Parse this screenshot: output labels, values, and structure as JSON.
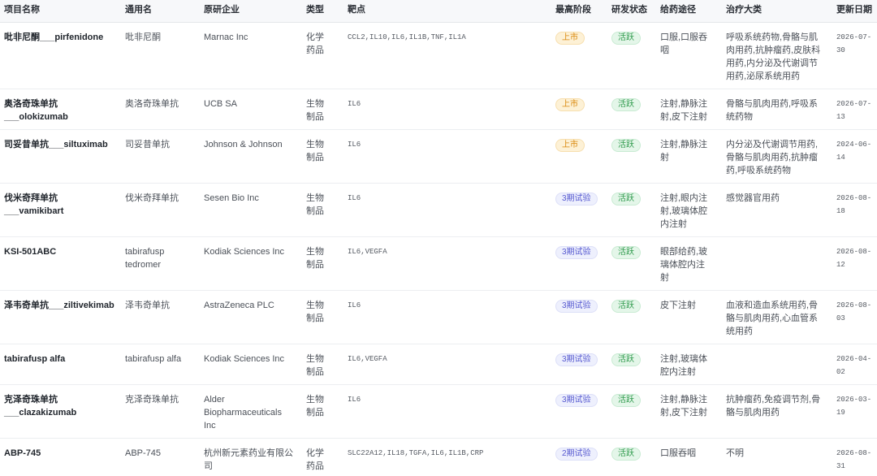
{
  "columns": [
    "项目名称",
    "通用名",
    "原研企业",
    "类型",
    "靶点",
    "最高阶段",
    "研发状态",
    "给药途径",
    "治疗大类",
    "更新日期"
  ],
  "rows": [
    {
      "name": "吡非尼酮___pirfenidone",
      "generic": "吡非尼酮",
      "company": "Marnac Inc",
      "type": "化学药品",
      "targets": "CCL2,IL10,IL6,IL1B,TNF,IL1A",
      "stage": "上市",
      "status": "活跃",
      "route": "口服,口服吞咽",
      "category": "呼吸系统药物,骨骼与肌肉用药,抗肿瘤药,皮肤科用药,内分泌及代谢调节用药,泌尿系统用药",
      "updated": "2026-07-30"
    },
    {
      "name": "奥洛奇珠单抗___olokizumab",
      "generic": "奥洛奇珠单抗",
      "company": "UCB SA",
      "type": "生物制品",
      "targets": "IL6",
      "stage": "上市",
      "status": "活跃",
      "route": "注射,静脉注射,皮下注射",
      "category": "骨骼与肌肉用药,呼吸系统药物",
      "updated": "2026-07-13"
    },
    {
      "name": "司妥昔单抗___siltuximab",
      "generic": "司妥昔单抗",
      "company": "Johnson & Johnson",
      "type": "生物制品",
      "targets": "IL6",
      "stage": "上市",
      "status": "活跃",
      "route": "注射,静脉注射",
      "category": "内分泌及代谢调节用药,骨骼与肌肉用药,抗肿瘤药,呼吸系统药物",
      "updated": "2024-06-14"
    },
    {
      "name": "伐米奇拜单抗___vamikibart",
      "generic": "伐米奇拜单抗",
      "company": "Sesen Bio Inc",
      "type": "生物制品",
      "targets": "IL6",
      "stage": "3期试验",
      "status": "活跃",
      "route": "注射,眼内注射,玻璃体腔内注射",
      "category": "感觉器官用药",
      "updated": "2026-08-18"
    },
    {
      "name": "KSI-501ABC",
      "generic": "tabirafusp tedromer",
      "company": "Kodiak Sciences Inc",
      "type": "生物制品",
      "targets": "IL6,VEGFA",
      "stage": "3期试验",
      "status": "活跃",
      "route": "眼部给药,玻璃体腔内注射",
      "updated": "2026-08-12"
    },
    {
      "name": "泽韦奇单抗___ziltivekimab",
      "generic": "泽韦奇单抗",
      "company": "AstraZeneca PLC",
      "type": "生物制品",
      "targets": "IL6",
      "stage": "3期试验",
      "status": "活跃",
      "route": "皮下注射",
      "category": "血液和造血系统用药,骨骼与肌肉用药,心血管系统用药",
      "updated": "2026-08-03"
    },
    {
      "name": "tabirafusp alfa",
      "generic": "tabirafusp alfa",
      "company": "Kodiak Sciences Inc",
      "type": "生物制品",
      "targets": "IL6,VEGFA",
      "stage": "3期试验",
      "status": "活跃",
      "route": "注射,玻璃体腔内注射",
      "updated": "2026-04-02"
    },
    {
      "name": "克泽奇珠单抗___clazakizumab",
      "generic": "克泽奇珠单抗",
      "company": "Alder Biopharmaceuticals Inc",
      "type": "生物制品",
      "targets": "IL6",
      "stage": "3期试验",
      "status": "活跃",
      "route": "注射,静脉注射,皮下注射",
      "category": "抗肿瘤药,免疫调节剂,骨骼与肌肉用药",
      "updated": "2026-03-19"
    },
    {
      "name": "ABP-745",
      "generic": "ABP-745",
      "company": "杭州新元素药业有限公司",
      "type": "化学药品",
      "targets": "SLC22A12,IL18,TGFA,IL6,IL1B,CRP",
      "stage": "2期试验",
      "status": "活跃",
      "route": "口服吞咽",
      "category": "不明",
      "updated": "2026-08-31"
    }
  ],
  "badge_colors": {
    "上市": {
      "bg": "#fdf1d6",
      "fg": "#d9870a",
      "border": "#f7dfae"
    },
    "3期试验": {
      "bg": "#eef0fd",
      "fg": "#5558d0",
      "border": "#dde0f8"
    },
    "2期试验": {
      "bg": "#eef0fd",
      "fg": "#5558d0",
      "border": "#dde0f8"
    },
    "活跃": {
      "bg": "#e4f6e9",
      "fg": "#2e9a4c",
      "border": "#c9ebd3"
    }
  }
}
